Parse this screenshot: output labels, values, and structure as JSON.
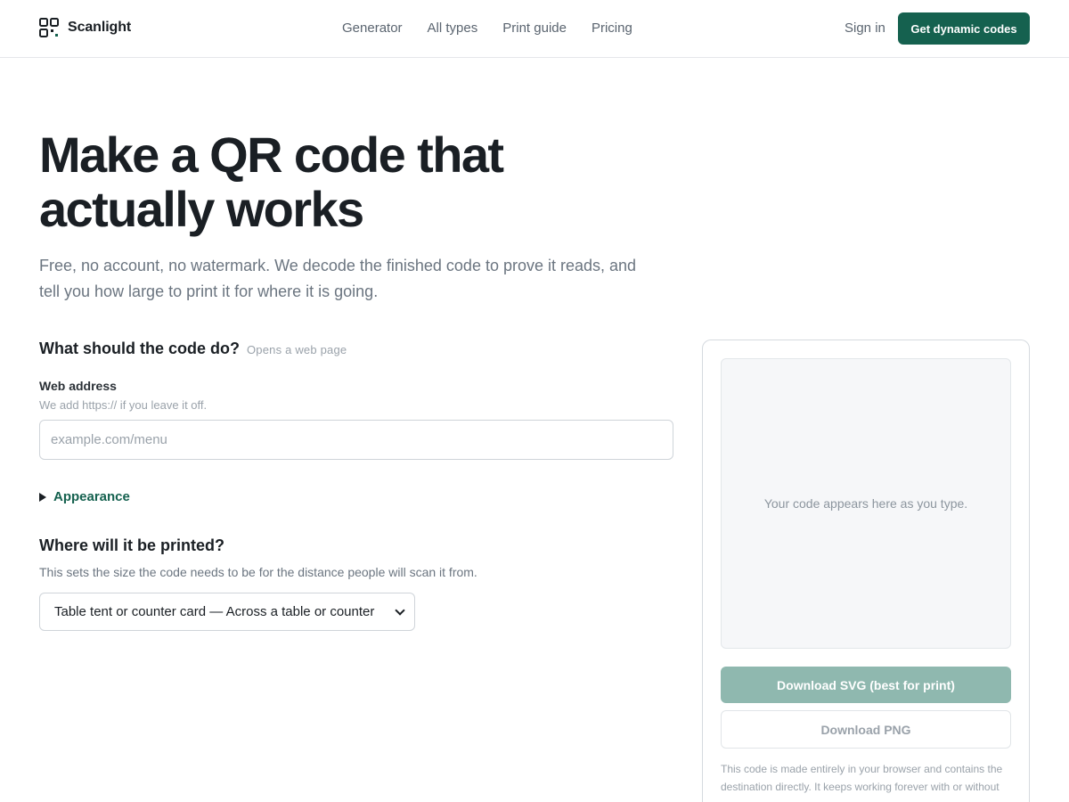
{
  "header": {
    "brand": "Scanlight",
    "logo_icon": "qr-logo-icon",
    "nav": [
      "Generator",
      "All types",
      "Print guide",
      "Pricing"
    ],
    "sign_in": "Sign in",
    "cta": "Get dynamic codes"
  },
  "hero": {
    "title": "Make a QR code that actually works",
    "subtitle": "Free, no account, no watermark. We decode the finished code to prove it reads, and tell you how large to print it for where it is going."
  },
  "form": {
    "question": "What should the code do?",
    "question_hint": "Opens a web page",
    "field_label": "Web address",
    "field_help": "We add https:// if you leave it off.",
    "field_value": "",
    "field_placeholder": "example.com/menu",
    "appearance_label": "Appearance",
    "print_question": "Where will it be printed?",
    "print_help": "This sets the size the code needs to be for the distance people will scan it from.",
    "print_selected": "Table tent or counter card — Across a table or counter"
  },
  "preview": {
    "placeholder": "Your code appears here as you type.",
    "download_svg": "Download SVG (best for print)",
    "download_png": "Download PNG",
    "note": "This code is made entirely in your browser and contains the destination directly. It keeps working forever with or without us."
  },
  "colors": {
    "brand": "#15614f",
    "disabled_brand": "#8fb8af",
    "text": "#1a1f24",
    "muted": "#6b7580"
  }
}
